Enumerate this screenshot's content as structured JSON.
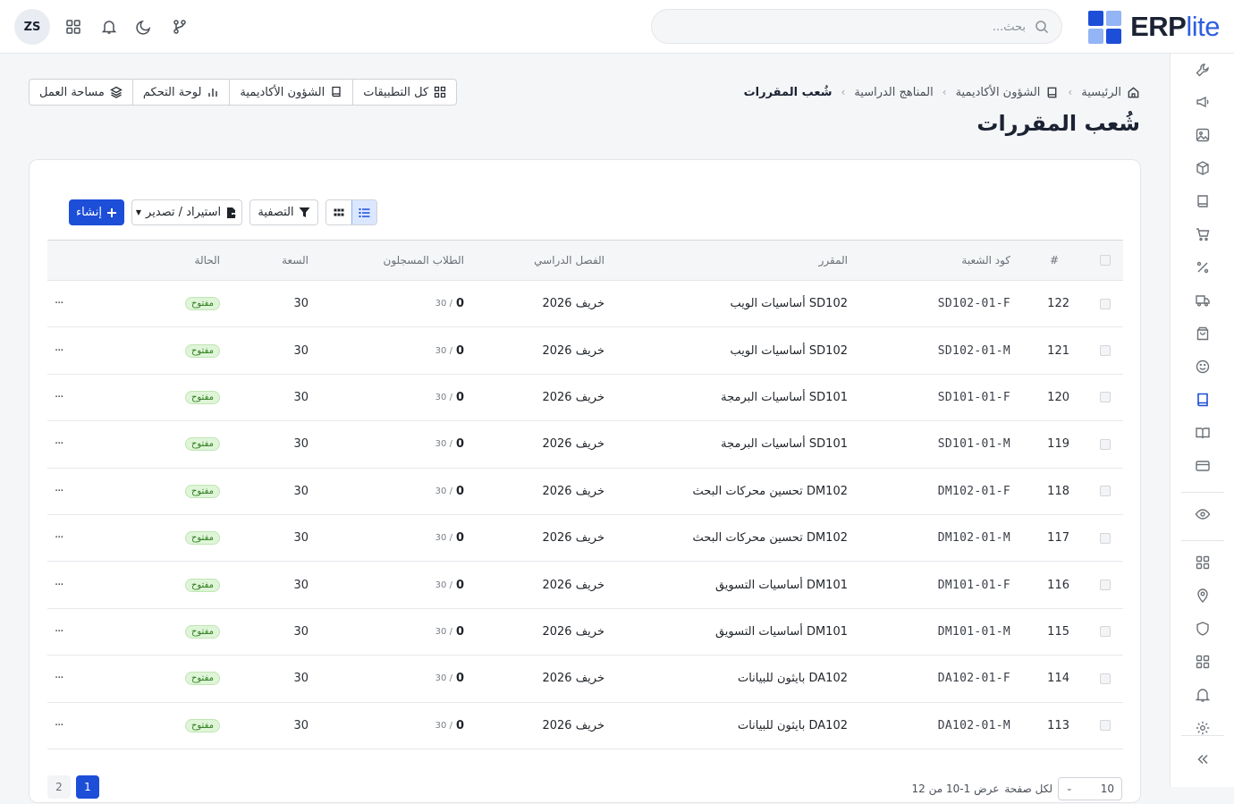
{
  "brand": {
    "name_bold": "ERP",
    "name_light": "lite",
    "colors": [
      "#1d4ed8",
      "#3b82f6",
      "#93b4f5",
      "#2f5fe0"
    ]
  },
  "header": {
    "search_placeholder": "بحث...",
    "user_initials": "ZS",
    "icons": [
      "apps-grid-icon",
      "bell-icon",
      "moon-icon",
      "git-branch-icon"
    ]
  },
  "breadcrumb": {
    "items": [
      "الرئيسية",
      "الشؤون الأكاديمية",
      "المناهج الدراسية",
      "شُعب المقررات"
    ]
  },
  "page": {
    "title": "شُعب المقررات"
  },
  "quick_nav": [
    "كل التطبيقات",
    "الشؤون الأكاديمية",
    "لوحة التحكم",
    "مساحة العمل"
  ],
  "toolbar": {
    "create": "إنشاء",
    "import_export": "استيراد / تصدير",
    "filter": "التصفية"
  },
  "table": {
    "columns": [
      "#",
      "كود الشعبة",
      "المقرر",
      "الفصل الدراسي",
      "الطلاب المسجلون",
      "السعة",
      "الحالة"
    ],
    "rows": [
      {
        "id": "122",
        "code": "SD102-01-F",
        "course": "SD102 أساسيات الويب",
        "term": "خريف 2026",
        "enrolled": "0",
        "cap_of": "30 /",
        "capacity": "30",
        "status": "مفتوح"
      },
      {
        "id": "121",
        "code": "SD102-01-M",
        "course": "SD102 أساسيات الويب",
        "term": "خريف 2026",
        "enrolled": "0",
        "cap_of": "30 /",
        "capacity": "30",
        "status": "مفتوح"
      },
      {
        "id": "120",
        "code": "SD101-01-F",
        "course": "SD101 أساسيات البرمجة",
        "term": "خريف 2026",
        "enrolled": "0",
        "cap_of": "30 /",
        "capacity": "30",
        "status": "مفتوح"
      },
      {
        "id": "119",
        "code": "SD101-01-M",
        "course": "SD101 أساسيات البرمجة",
        "term": "خريف 2026",
        "enrolled": "0",
        "cap_of": "30 /",
        "capacity": "30",
        "status": "مفتوح"
      },
      {
        "id": "118",
        "code": "DM102-01-F",
        "course": "DM102 تحسين محركات البحث",
        "term": "خريف 2026",
        "enrolled": "0",
        "cap_of": "30 /",
        "capacity": "30",
        "status": "مفتوح"
      },
      {
        "id": "117",
        "code": "DM102-01-M",
        "course": "DM102 تحسين محركات البحث",
        "term": "خريف 2026",
        "enrolled": "0",
        "cap_of": "30 /",
        "capacity": "30",
        "status": "مفتوح"
      },
      {
        "id": "116",
        "code": "DM101-01-F",
        "course": "DM101 أساسيات التسويق",
        "term": "خريف 2026",
        "enrolled": "0",
        "cap_of": "30 /",
        "capacity": "30",
        "status": "مفتوح"
      },
      {
        "id": "115",
        "code": "DM101-01-M",
        "course": "DM101 أساسيات التسويق",
        "term": "خريف 2026",
        "enrolled": "0",
        "cap_of": "30 /",
        "capacity": "30",
        "status": "مفتوح"
      },
      {
        "id": "114",
        "code": "DA102-01-F",
        "course": "DA102 بايثون للبيانات",
        "term": "خريف 2026",
        "enrolled": "0",
        "cap_of": "30 /",
        "capacity": "30",
        "status": "مفتوح"
      },
      {
        "id": "113",
        "code": "DA102-01-M",
        "course": "DA102 بايثون للبيانات",
        "term": "خريف 2026",
        "enrolled": "0",
        "cap_of": "30 /",
        "capacity": "30",
        "status": "مفتوح"
      }
    ],
    "row_menu": "···"
  },
  "pagination": {
    "pages": [
      "1",
      "2"
    ],
    "current": "1",
    "info": "عرض 1-10 من 12",
    "per_page_label": "لكل صفحة",
    "per_page": "10"
  },
  "sidebar_icons": [
    "wrench-icon",
    "megaphone-icon",
    "image-icon",
    "box-icon",
    "book-icon",
    "cart-icon",
    "percent-icon",
    "truck-icon",
    "shopping-bag-icon",
    "smile-icon",
    "notebook-icon",
    "open-book-icon",
    "credit-card-icon",
    "eye-icon",
    "grid-icon",
    "map-pin-icon",
    "shield-icon",
    "apps-icon",
    "bell-icon",
    "settings-icon",
    "collapse-icon"
  ]
}
